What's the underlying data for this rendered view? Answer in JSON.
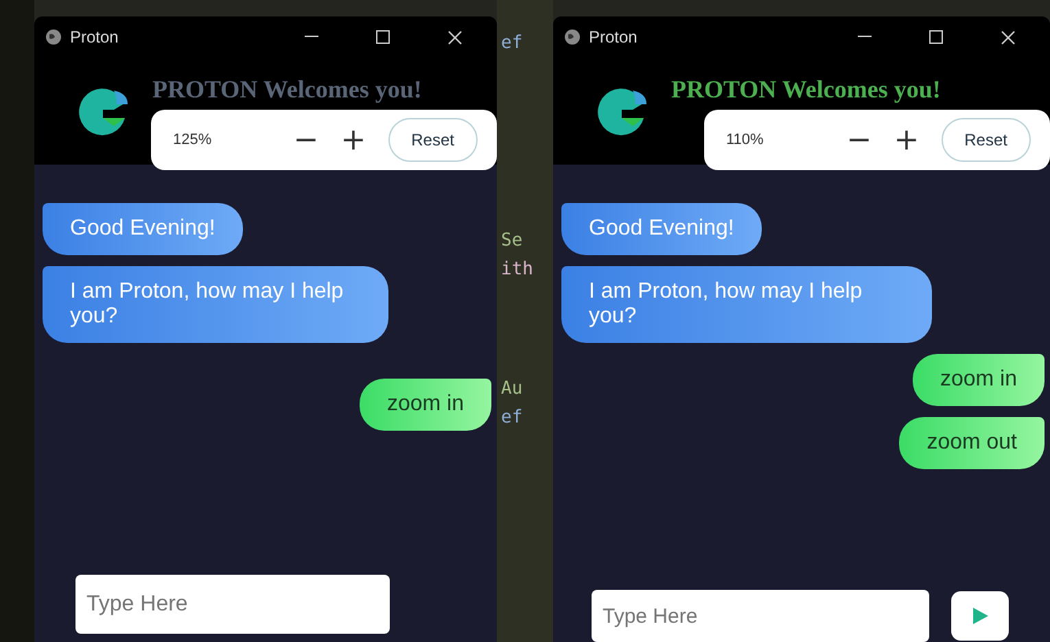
{
  "editor_fragments": [
    "ef",
    "Se",
    "ith",
    "Au",
    "ef"
  ],
  "windows": [
    {
      "title": "Proton",
      "heading": "PROTON Welcomes you!",
      "color": "#5a6678",
      "zoom": {
        "level_text": "125%",
        "minus": "−",
        "plus": "+",
        "reset": "Reset"
      },
      "messages": [
        {
          "kind": "bot",
          "text": "Good Evening!"
        },
        {
          "kind": "bot",
          "text": "I am Proton, how may I help you?"
        },
        {
          "kind": "user",
          "text": "zoom in"
        }
      ],
      "input": {
        "placeholder": "Type Here"
      },
      "send_button": false
    },
    {
      "title": "Proton",
      "heading": "PROTON Welcomes you!",
      "color": "#4caf50",
      "zoom": {
        "level_text": "110%",
        "minus": "−",
        "plus": "+",
        "reset": "Reset"
      },
      "messages": [
        {
          "kind": "bot",
          "text": "Good Evening!"
        },
        {
          "kind": "bot",
          "text": "I am Proton, how may I help you?"
        },
        {
          "kind": "user",
          "text": "zoom in"
        },
        {
          "kind": "user",
          "text": "zoom out"
        }
      ],
      "input": {
        "placeholder": "Type Here"
      },
      "send_button": true
    }
  ]
}
